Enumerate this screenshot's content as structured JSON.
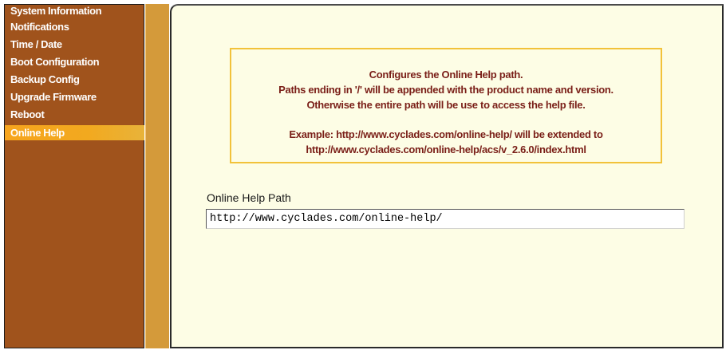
{
  "sidebar": {
    "items": [
      {
        "label": "System Information"
      },
      {
        "label": "Notifications"
      },
      {
        "label": "Time / Date"
      },
      {
        "label": "Boot Configuration"
      },
      {
        "label": "Backup Config"
      },
      {
        "label": "Upgrade Firmware"
      },
      {
        "label": "Reboot"
      },
      {
        "label": "Online Help"
      }
    ],
    "active_item": "Online Help"
  },
  "info": {
    "line1": "Configures the Online Help path.",
    "line2": "Paths ending in '/' will be appended with the product name and version.",
    "line3": "Otherwise the entire path will be use to access the help file.",
    "line4": "Example: http://www.cyclades.com/online-help/ will be extended to",
    "line5": "http://www.cyclades.com/online-help/acs/v_2.6.0/index.html"
  },
  "form": {
    "label": "Online Help Path",
    "value": "http://www.cyclades.com/online-help/"
  },
  "colors": {
    "sidebar_bg": "#a0531c",
    "active_item_bg": "#f5a623",
    "content_bg": "#fdfde5",
    "info_text": "#7a1f18",
    "info_border": "#f2c23a"
  }
}
